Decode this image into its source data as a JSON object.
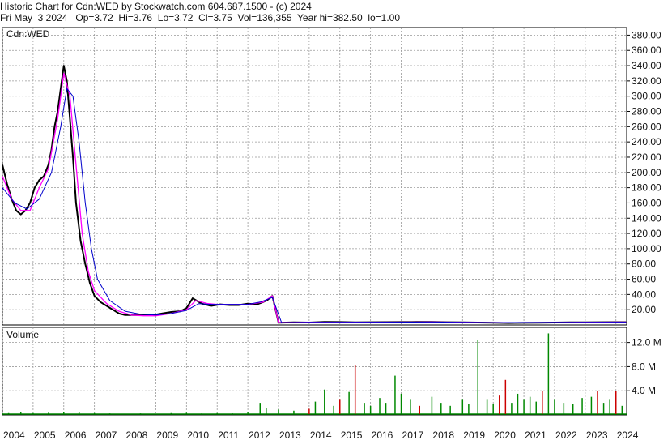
{
  "header": {
    "line1": "Historic Chart for Cdn:WED by Stockwatch.com 604.687.1500 - (c) 2024",
    "line2": "Fri May  3 2024   Op=3.72  Hi=3.76  Lo=3.72  Cl=3.75  Vol=136,355  Year hi=382.50  lo=1.00"
  },
  "colors": {
    "background": "#ffffff",
    "grid": "#999999",
    "price_bar": "#000000",
    "ma_short": "#ff00ff",
    "ma_long": "#0000cc",
    "vol_low": "#008800",
    "vol_high": "#cc0000"
  },
  "chart_data": [
    {
      "type": "line",
      "label": "Cdn:WED",
      "yticks": [
        "380.00",
        "360.00",
        "340.00",
        "320.00",
        "300.00",
        "280.00",
        "260.00",
        "240.00",
        "220.00",
        "200.00",
        "180.00",
        "160.00",
        "140.00",
        "120.00",
        "100.00",
        "80.00",
        "60.00",
        "40.00",
        "20.00"
      ],
      "ylim": [
        0,
        390
      ],
      "xlim": [
        2004,
        2024.35
      ],
      "series": [
        {
          "role": "price",
          "x": [
            2004.0,
            2004.15,
            2004.3,
            2004.45,
            2004.6,
            2004.75,
            2004.9,
            2005.05,
            2005.2,
            2005.35,
            2005.5,
            2005.6,
            2005.7,
            2005.8,
            2005.9,
            2006.0,
            2006.1,
            2006.2,
            2006.3,
            2006.4,
            2006.55,
            2006.7,
            2006.85,
            2007.0,
            2007.2,
            2007.4,
            2007.6,
            2007.8,
            2008.0,
            2008.3,
            2008.6,
            2008.9,
            2009.2,
            2009.5,
            2009.8,
            2010.0,
            2010.2,
            2010.5,
            2010.8,
            2011.1,
            2011.4,
            2011.7,
            2012.0,
            2012.3,
            2012.5,
            2012.65,
            2012.8,
            2013.0,
            2013.5,
            2014.0,
            2014.5,
            2015.0,
            2015.5,
            2016.0,
            2016.5,
            2017.0,
            2017.5,
            2018.0,
            2018.5,
            2019.0,
            2019.5,
            2020.0,
            2020.5,
            2021.0,
            2021.5,
            2022.0,
            2022.5,
            2023.0,
            2023.5,
            2024.0,
            2024.33
          ],
          "values": [
            210,
            185,
            165,
            150,
            145,
            150,
            160,
            180,
            190,
            195,
            210,
            230,
            260,
            280,
            310,
            340,
            320,
            270,
            220,
            160,
            110,
            80,
            55,
            38,
            30,
            25,
            20,
            15,
            13,
            13,
            13,
            13,
            15,
            17,
            18,
            22,
            35,
            28,
            25,
            27,
            26,
            26,
            28,
            27,
            30,
            33,
            38,
            3,
            3.5,
            3.2,
            4,
            3.8,
            3.5,
            3.6,
            3.7,
            3.8,
            3.9,
            4,
            3.6,
            3.5,
            3.2,
            3,
            2.5,
            2.8,
            3,
            3.2,
            3.4,
            3.5,
            3.6,
            3.7,
            3.75
          ]
        },
        {
          "role": "moving-average-short",
          "x": [
            2004.0,
            2004.3,
            2004.6,
            2004.9,
            2005.2,
            2005.5,
            2005.8,
            2006.0,
            2006.2,
            2006.4,
            2006.6,
            2006.8,
            2007.0,
            2007.4,
            2007.8,
            2008.2,
            2008.6,
            2009.0,
            2009.5,
            2010.0,
            2010.3,
            2010.7,
            2011.0,
            2011.5,
            2012.0,
            2012.5,
            2012.8,
            2013.0,
            2014.0,
            2016.0,
            2018.0,
            2020.0,
            2022.0,
            2024.33
          ],
          "values": [
            195,
            165,
            150,
            150,
            180,
            205,
            270,
            330,
            300,
            210,
            120,
            70,
            45,
            28,
            18,
            13,
            12,
            12,
            15,
            20,
            32,
            28,
            27,
            27,
            27,
            30,
            38,
            3,
            3.4,
            3.6,
            3.8,
            3,
            3.2,
            3.7
          ]
        },
        {
          "role": "moving-average-long",
          "x": [
            2004.0,
            2004.4,
            2004.8,
            2005.2,
            2005.6,
            2005.9,
            2006.1,
            2006.3,
            2006.5,
            2006.7,
            2006.9,
            2007.1,
            2007.5,
            2008.0,
            2008.5,
            2009.0,
            2009.5,
            2010.0,
            2010.4,
            2010.8,
            2011.2,
            2011.6,
            2012.0,
            2012.4,
            2012.8,
            2013.1,
            2014.0,
            2016.0,
            2018.0,
            2020.0,
            2022.0,
            2024.33
          ],
          "values": [
            180,
            160,
            152,
            165,
            200,
            260,
            310,
            300,
            240,
            160,
            100,
            60,
            32,
            18,
            14,
            13,
            15,
            19,
            28,
            27,
            27,
            27,
            27,
            30,
            36,
            3,
            3.5,
            3.6,
            3.8,
            3.1,
            3.3,
            3.6
          ]
        }
      ]
    },
    {
      "type": "bar",
      "label": "Volume",
      "yticks": [
        "12.0 M",
        "8.0 M",
        "4.0 M"
      ],
      "ylim": [
        0,
        14500000
      ],
      "x": [
        2004.2,
        2004.6,
        2005.0,
        2005.5,
        2006.0,
        2006.5,
        2007.0,
        2007.5,
        2008.0,
        2008.5,
        2009.0,
        2009.5,
        2010.0,
        2010.5,
        2011.0,
        2011.5,
        2012.0,
        2012.4,
        2012.6,
        2013.0,
        2013.5,
        2014.0,
        2014.2,
        2014.5,
        2014.8,
        2015.0,
        2015.3,
        2015.5,
        2015.8,
        2016.0,
        2016.3,
        2016.5,
        2016.8,
        2017.0,
        2017.3,
        2017.6,
        2018.0,
        2018.3,
        2018.6,
        2019.0,
        2019.2,
        2019.5,
        2019.8,
        2020.0,
        2020.2,
        2020.4,
        2020.6,
        2020.8,
        2021.0,
        2021.2,
        2021.4,
        2021.6,
        2021.8,
        2022.0,
        2022.3,
        2022.6,
        2022.9,
        2023.2,
        2023.4,
        2023.6,
        2023.8,
        2024.0,
        2024.2
      ],
      "values": [
        300000,
        400000,
        300000,
        350000,
        500000,
        400000,
        300000,
        250000,
        200000,
        250000,
        200000,
        300000,
        350000,
        250000,
        300000,
        250000,
        400000,
        2000000,
        1200000,
        900000,
        700000,
        1000000,
        2200000,
        4200000,
        1500000,
        2500000,
        3800000,
        8200000,
        2000000,
        1500000,
        2800000,
        2000000,
        6500000,
        3500000,
        2500000,
        1500000,
        3000000,
        2000000,
        1500000,
        2500000,
        1800000,
        12400000,
        2500000,
        1800000,
        3200000,
        5800000,
        2000000,
        3500000,
        2500000,
        3000000,
        2200000,
        4000000,
        13500000,
        2500000,
        2000000,
        1800000,
        2800000,
        3000000,
        4000000,
        2000000,
        2500000,
        4000000,
        1500000
      ],
      "high": [
        false,
        false,
        false,
        false,
        false,
        false,
        false,
        false,
        false,
        false,
        false,
        false,
        false,
        false,
        false,
        false,
        false,
        false,
        false,
        false,
        false,
        true,
        false,
        false,
        false,
        true,
        false,
        true,
        false,
        false,
        false,
        false,
        false,
        false,
        false,
        true,
        false,
        false,
        false,
        false,
        false,
        false,
        false,
        false,
        true,
        true,
        false,
        false,
        false,
        false,
        false,
        true,
        false,
        false,
        false,
        false,
        false,
        false,
        true,
        false,
        false,
        true,
        false
      ]
    }
  ],
  "price_panel": {
    "label": "Cdn:WED"
  },
  "volume_panel": {
    "label": "Volume"
  },
  "xaxis": {
    "years": [
      "2004",
      "2005",
      "2006",
      "2007",
      "2008",
      "2009",
      "2010",
      "2011",
      "2012",
      "2013",
      "2014",
      "2015",
      "2016",
      "2017",
      "2018",
      "2019",
      "2020",
      "2021",
      "2022",
      "2023",
      "2024"
    ],
    "year_values": [
      2004,
      2005,
      2006,
      2007,
      2008,
      2009,
      2010,
      2011,
      2012,
      2013,
      2014,
      2015,
      2016,
      2017,
      2018,
      2019,
      2020,
      2021,
      2022,
      2023,
      2024
    ]
  }
}
